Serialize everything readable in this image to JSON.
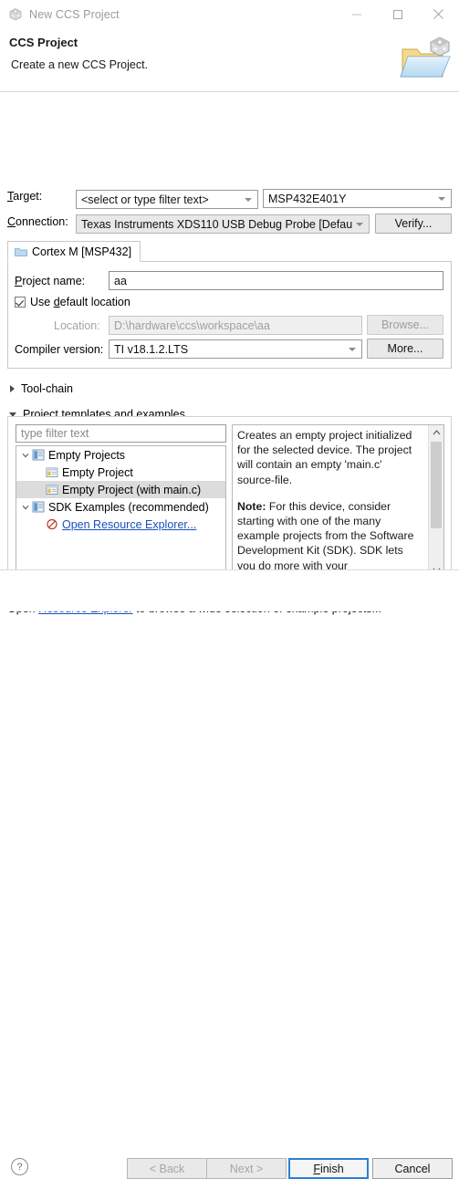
{
  "window": {
    "title": "New CCS Project",
    "icon": "ccs-cube-icon",
    "minimize_label": "—",
    "maximize_label": "□",
    "close_label": "✕"
  },
  "header": {
    "title": "CCS Project",
    "subtitle": "Create a new CCS Project.",
    "icon": "new-project-folder-icon"
  },
  "form": {
    "target": {
      "label": "Target:",
      "label_mnemonic": "T",
      "filter_value": "<select or type filter text>",
      "device_value": "MSP432E401Y"
    },
    "connection": {
      "label": "Connection:",
      "label_mnemonic": "C",
      "value": "Texas Instruments XDS110 USB Debug Probe [Defau",
      "verify_button": "Verify..."
    },
    "tab": {
      "label": "Cortex M [MSP432]",
      "icon": "folder-icon"
    },
    "project_name": {
      "label": "Project name:",
      "label_mnemonic": "P",
      "value": "aa"
    },
    "use_default_location": {
      "label": "Use default location",
      "checked": true
    },
    "location": {
      "label": "Location:",
      "value": "D:\\hardware\\ccs\\workspace\\aa",
      "browse_button": "Browse..."
    },
    "compiler_version": {
      "label": "Compiler version:",
      "value": "TI v18.1.2.LTS",
      "more_button": "More..."
    }
  },
  "sections": {
    "toolchain": {
      "label": "Tool-chain",
      "expanded": false
    },
    "templates": {
      "label": "Project templates and examples",
      "expanded": true
    }
  },
  "templates": {
    "filter_placeholder": "type filter text",
    "tree": [
      {
        "label": "Empty Projects",
        "level": 0,
        "twisty": "expanded",
        "icon": "folder-template-icon",
        "selected": false,
        "link": false
      },
      {
        "label": "Empty Project",
        "level": 1,
        "twisty": "none",
        "icon": "project-icon",
        "selected": false,
        "link": false
      },
      {
        "label": "Empty Project (with main.c)",
        "level": 1,
        "twisty": "none",
        "icon": "project-icon",
        "selected": true,
        "link": false
      },
      {
        "label": "SDK Examples (recommended)",
        "level": 0,
        "twisty": "expanded",
        "icon": "folder-template-icon",
        "selected": false,
        "link": false
      },
      {
        "label": "Open Resource Explorer...",
        "level": 1,
        "twisty": "none",
        "icon": "resource-explorer-icon",
        "selected": false,
        "link": true
      }
    ],
    "description": {
      "paragraph1": "Creates an empty project initialized for the selected device. The project will contain an empty 'main.c' source-file.",
      "note_label": "Note:",
      "paragraph2": " For this device, consider starting with one of the many example projects from the Software Development Kit (SDK). SDK lets you do more with your"
    },
    "scrollbar": {
      "up_arrow": "⌃",
      "down_arrow": "⌄"
    }
  },
  "footnote": {
    "prefix": "Open ",
    "link": "Resource Explorer",
    "suffix": " to browse a wide selection of example projects..."
  },
  "footer": {
    "help_label": "?",
    "back_button": "< Back",
    "next_button": "Next >",
    "finish_button": "Finish",
    "finish_mnemonic": "F",
    "cancel_button": "Cancel"
  },
  "colors": {
    "accent_blue": "#2b7fd4",
    "link_blue": "#1a4fbd",
    "selection_grey": "#dcdcdc"
  }
}
